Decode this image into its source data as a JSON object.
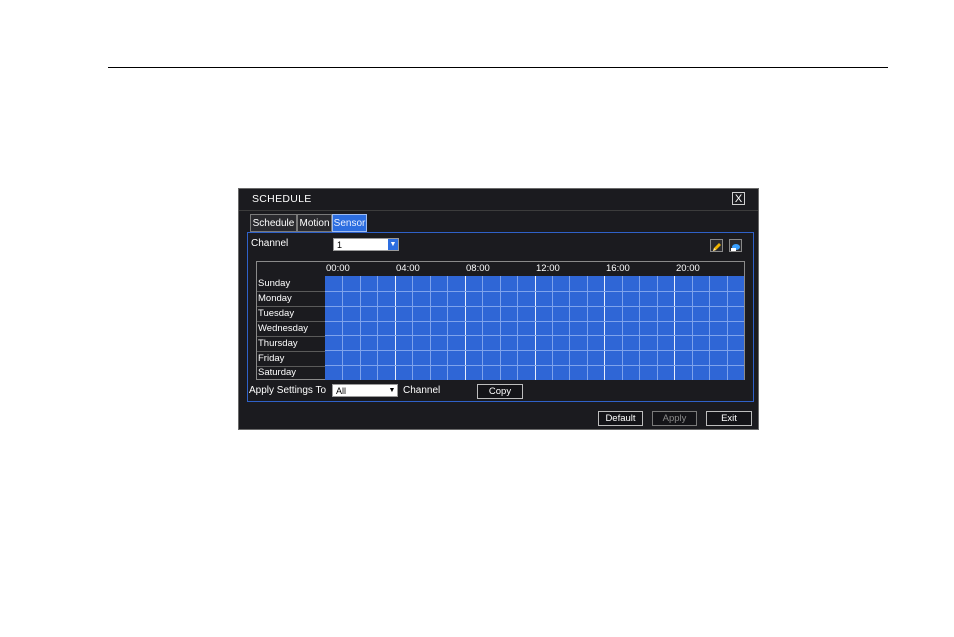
{
  "window": {
    "title": "SCHEDULE",
    "close_label": "X"
  },
  "tabs": [
    {
      "label": "Schedule",
      "active": false
    },
    {
      "label": "Motion",
      "active": false
    },
    {
      "label": "Sensor",
      "active": true
    }
  ],
  "channel": {
    "label": "Channel",
    "value": "1"
  },
  "grid": {
    "times": [
      "00:00",
      "04:00",
      "08:00",
      "12:00",
      "16:00",
      "20:00"
    ],
    "days": [
      "Sunday",
      "Monday",
      "Tuesday",
      "Wednesday",
      "Thursday",
      "Friday",
      "Saturday"
    ],
    "scheduled_all": true
  },
  "apply": {
    "label": "Apply Settings To",
    "value": "All",
    "suffix": "Channel",
    "copy_label": "Copy"
  },
  "buttons": {
    "default_label": "Default",
    "apply_label": "Apply",
    "exit_label": "Exit"
  },
  "colors": {
    "schedule_fill": "#2f66d6",
    "tab_active": "#2d6ee0",
    "window_bg": "#1b1b1f"
  },
  "icons": {
    "edit": "pencil-icon",
    "erase": "eraser-icon"
  }
}
